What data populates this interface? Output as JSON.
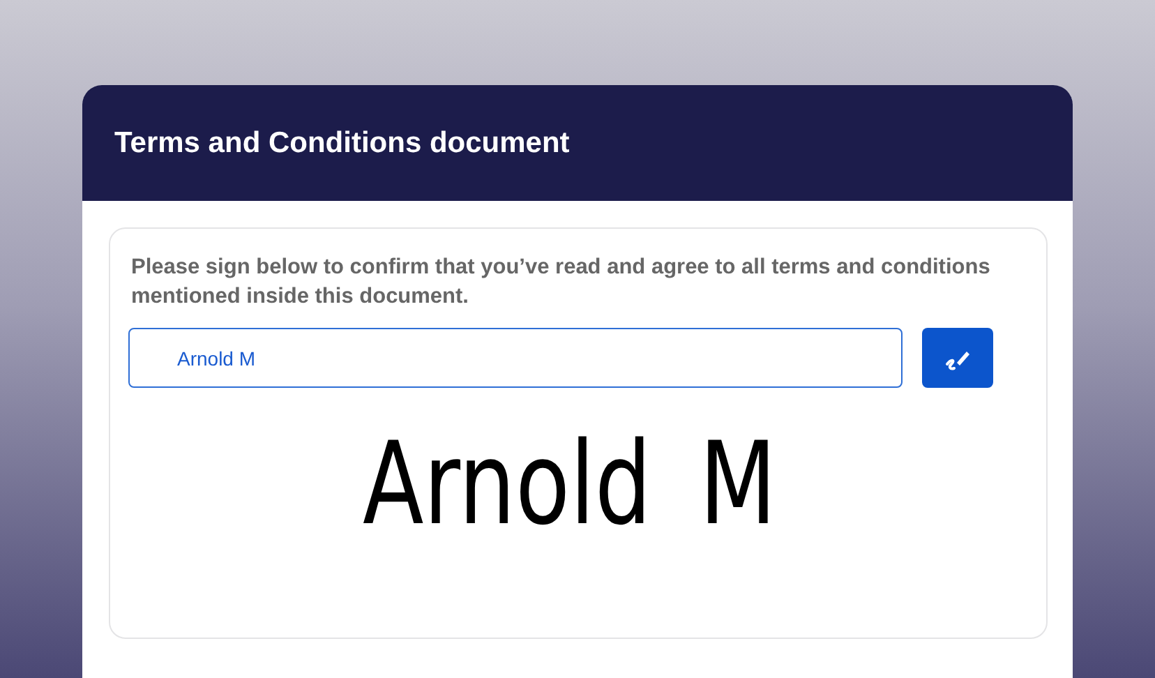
{
  "header": {
    "title": "Terms and Conditions document"
  },
  "panel": {
    "instruction": "Please sign below to confirm that you’ve read and agree to all terms and conditions mentioned inside this document.",
    "name_field": {
      "value": "Arnold M"
    },
    "signature": "Arnold M"
  }
}
